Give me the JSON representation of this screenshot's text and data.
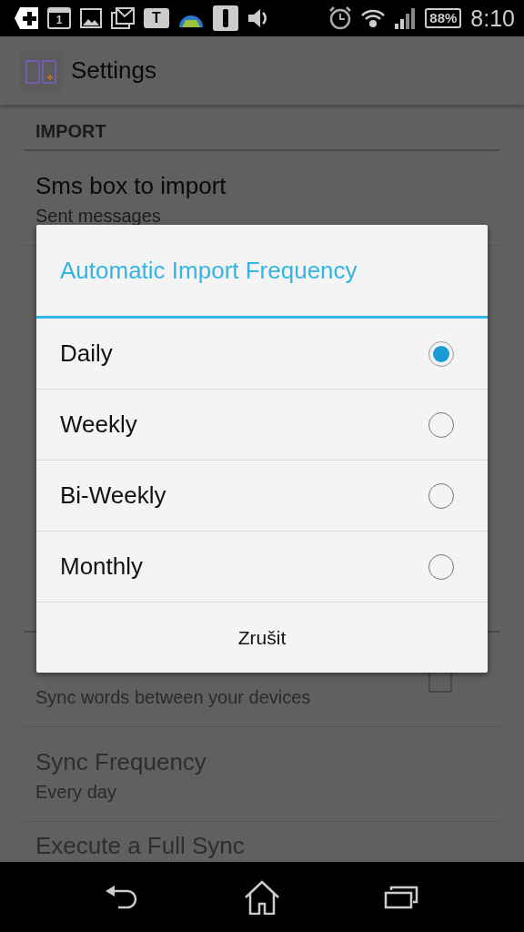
{
  "status_bar": {
    "calendar_day": "1",
    "chat_letter": "T",
    "battery": "88%",
    "time": "8:10"
  },
  "action_bar": {
    "title": "Settings"
  },
  "settings": {
    "sections": [
      {
        "header": "IMPORT",
        "items": [
          {
            "kind": "text",
            "title": "Sms box to import",
            "summary": "Sent messages",
            "disabled": false
          }
        ]
      },
      {
        "items": [
          {
            "kind": "checkbox",
            "summary": "Sync words between your devices",
            "disabled": true,
            "checked": false
          },
          {
            "kind": "text",
            "title": "Sync Frequency",
            "summary": "Every day",
            "disabled": true
          },
          {
            "kind": "text",
            "title": "Execute a Full Sync",
            "disabled": true
          }
        ]
      }
    ]
  },
  "dialog": {
    "title": "Automatic Import Frequency",
    "options": [
      {
        "label": "Daily",
        "selected": true
      },
      {
        "label": "Weekly",
        "selected": false
      },
      {
        "label": "Bi-Weekly",
        "selected": false
      },
      {
        "label": "Monthly",
        "selected": false
      }
    ],
    "buttons": [
      "Zrušit"
    ]
  }
}
